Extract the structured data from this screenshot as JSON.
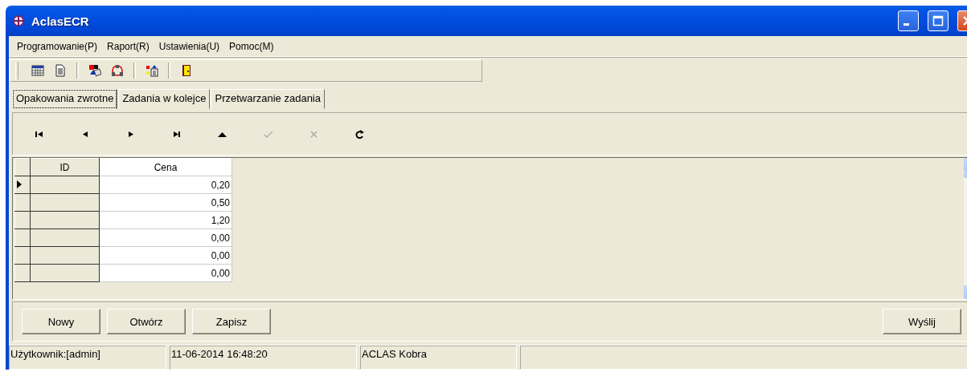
{
  "window": {
    "title": "AclasECR"
  },
  "menu": [
    "Programowanie(P)",
    "Raport(R)",
    "Ustawienia(U)",
    "Pomoc(M)"
  ],
  "tabs": [
    {
      "label": "Opakowania zwrotne",
      "selected": true
    },
    {
      "label": "Zadania w kolejce",
      "selected": false
    },
    {
      "label": "Przetwarzanie zadania",
      "selected": false
    }
  ],
  "navigator": [
    {
      "kind": "first",
      "disabled": false
    },
    {
      "kind": "prior",
      "disabled": false
    },
    {
      "kind": "next",
      "disabled": false
    },
    {
      "kind": "last",
      "disabled": false
    },
    {
      "kind": "edit",
      "disabled": false
    },
    {
      "kind": "post",
      "disabled": true
    },
    {
      "kind": "cancel",
      "disabled": true
    },
    {
      "kind": "refresh",
      "disabled": false
    }
  ],
  "grid": {
    "columns": [
      "ID",
      "Cena"
    ],
    "rows": [
      {
        "price": "0,20",
        "current": true
      },
      {
        "price": "0,50",
        "current": false
      },
      {
        "price": "1,20",
        "current": false
      },
      {
        "price": "0,00",
        "current": false
      },
      {
        "price": "0,00",
        "current": false
      },
      {
        "price": "0,00",
        "current": false
      }
    ]
  },
  "buttons_left": [
    "Nowy",
    "Otwórz",
    "Zapisz"
  ],
  "button_right": "Wyślij",
  "status_bar": [
    "Użytkownik:[admin]",
    "11-06-2014 16:48:20",
    "ACLAS Kobra"
  ]
}
